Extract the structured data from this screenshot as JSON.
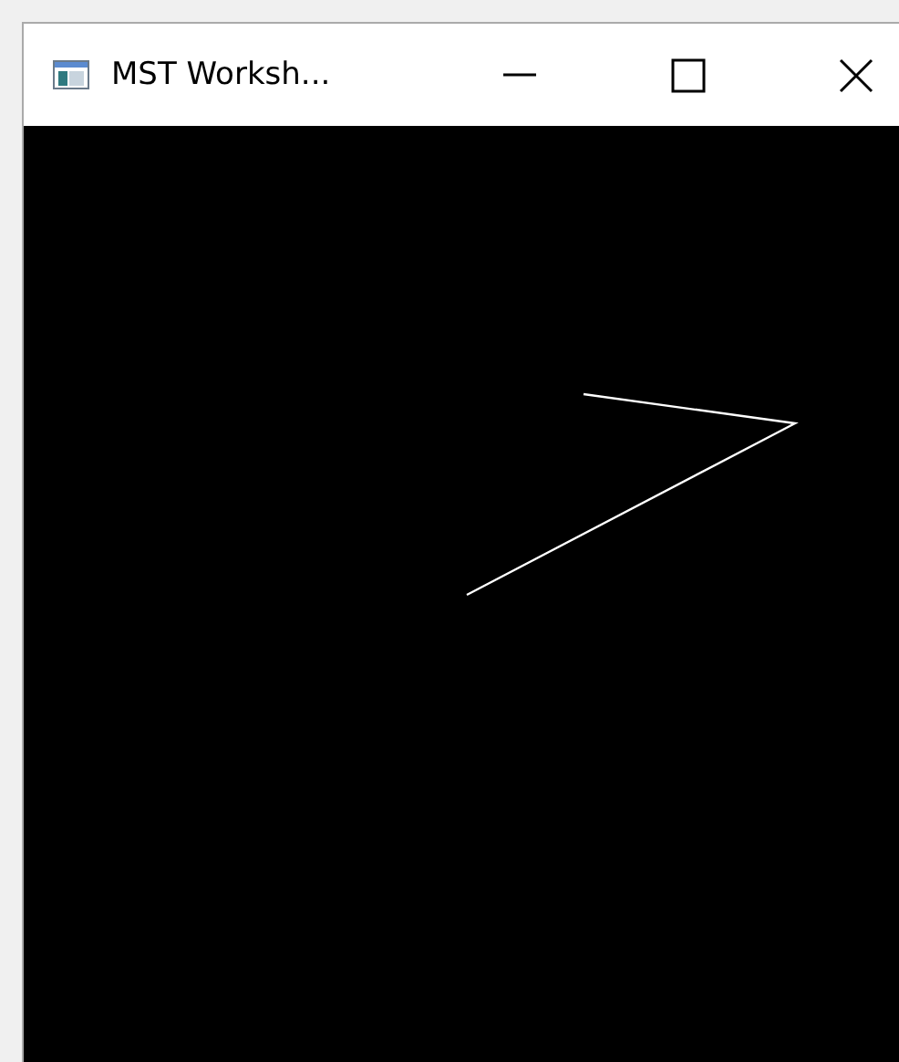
{
  "window": {
    "title": "MST Worksh..."
  }
}
